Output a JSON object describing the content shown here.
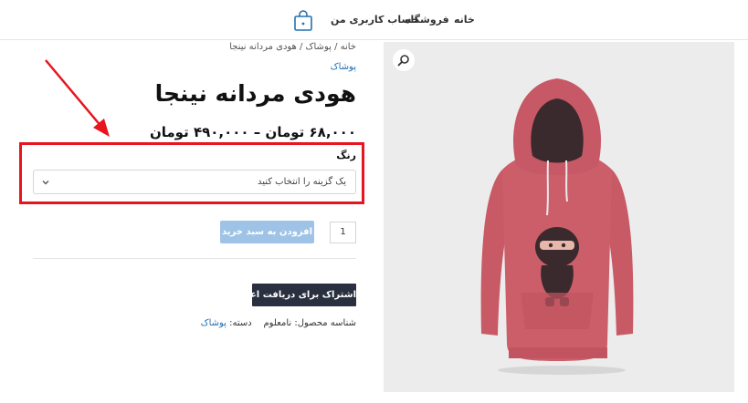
{
  "nav": {
    "home": "خانه",
    "shop": "فروشگاه",
    "account": "حساب کاربری من",
    "cart_icon": "shopping-bag-icon"
  },
  "product": {
    "breadcrumb": "خانه / پوشاک / هودی مردانه نینجا",
    "category_link": "پوشاک",
    "title": "هودی مردانه نینجا",
    "price": "۶۸,۰۰۰ تومان – ۴۹۰,۰۰۰ تومان",
    "variation_label": "رنگ",
    "select_placeholder": "یک گزینه را انتخاب کنید",
    "quantity": "1",
    "add_to_cart": "افزودن به سبد خرید",
    "subscribe": "اشتراک برای دریافت اعلان",
    "meta_sku_label": "شناسه محصول:",
    "meta_sku_value": "نامعلوم",
    "meta_category_label": "دسته:",
    "meta_category_value": "پوشاک"
  },
  "gallery": {
    "zoom_icon": "magnifier-icon",
    "hoodie_color": "#cc5e6a"
  },
  "colors": {
    "link": "#2271b1",
    "button_disabled": "#9fc3e6",
    "button_dark": "#2b3040",
    "annotation": "#e8141e"
  }
}
